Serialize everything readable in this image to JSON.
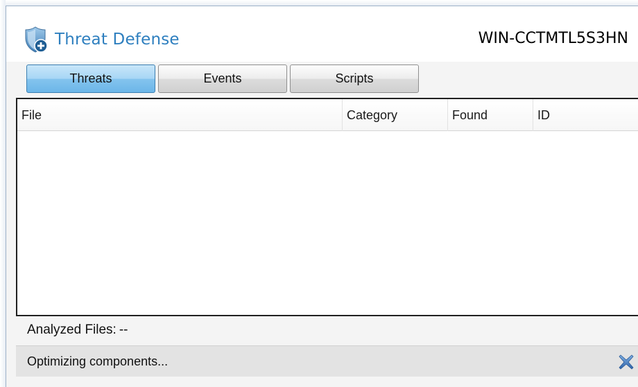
{
  "app": {
    "title": "Threat Defense",
    "host_name": "WIN-CCTMTL5S3HN",
    "icon": "shield-icon"
  },
  "tabs": [
    {
      "label": "Threats",
      "active": true
    },
    {
      "label": "Events",
      "active": false
    },
    {
      "label": "Scripts",
      "active": false
    }
  ],
  "table": {
    "columns": [
      "File",
      "Category",
      "Found",
      "ID"
    ],
    "rows": []
  },
  "summary": {
    "analyzed_label": "Analyzed Files:",
    "analyzed_value": "--"
  },
  "status": {
    "text": "Optimizing components...",
    "close_icon": "close-icon"
  },
  "colors": {
    "accent": "#2e7fbf",
    "active_tab": "#84c4ee",
    "close": "#4a7fc1"
  }
}
